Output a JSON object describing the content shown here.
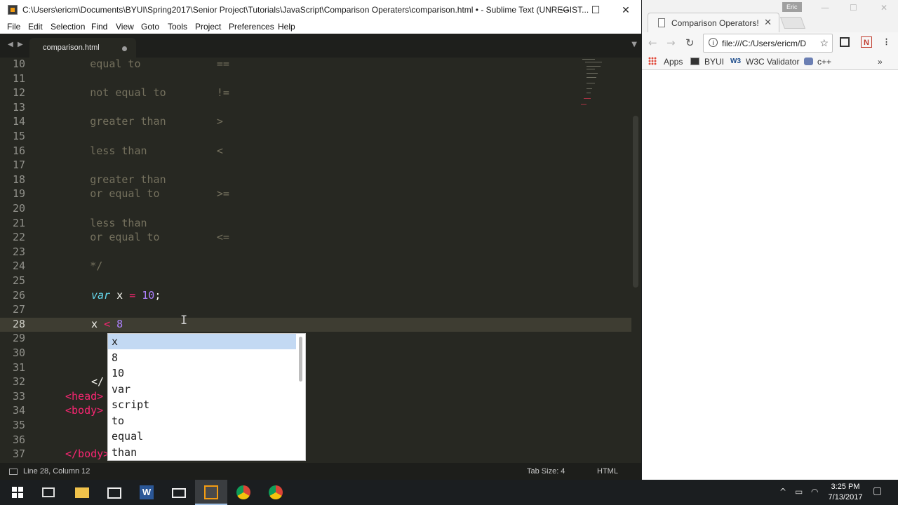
{
  "sublime": {
    "title": "C:\\Users\\ericm\\Documents\\BYUI\\Spring2017\\Senior Project\\Tutorials\\JavaScript\\Comparison Operaters\\comparison.html • - Sublime Text (UNREGIST...",
    "menu": [
      "File",
      "Edit",
      "Selection",
      "Find",
      "View",
      "Goto",
      "Tools",
      "Project",
      "Preferences",
      "Help"
    ],
    "tab_label": "comparison.html",
    "lines": [
      {
        "n": "10",
        "text": "        equal to            =="
      },
      {
        "n": "11",
        "text": ""
      },
      {
        "n": "12",
        "text": "        not equal to        !="
      },
      {
        "n": "13",
        "text": ""
      },
      {
        "n": "14",
        "text": "        greater than        >"
      },
      {
        "n": "15",
        "text": ""
      },
      {
        "n": "16",
        "text": "        less than           <"
      },
      {
        "n": "17",
        "text": ""
      },
      {
        "n": "18",
        "text": "        greater than"
      },
      {
        "n": "19",
        "text": "        or equal to         >="
      },
      {
        "n": "20",
        "text": ""
      },
      {
        "n": "21",
        "text": "        less than"
      },
      {
        "n": "22",
        "text": "        or equal to         <="
      },
      {
        "n": "23",
        "text": ""
      },
      {
        "n": "24",
        "text": "        */"
      },
      {
        "n": "25",
        "text": ""
      },
      {
        "n": "26",
        "var": "var",
        "x": "x",
        "eq": "=",
        "val": "10",
        "semi": ";"
      },
      {
        "n": "27",
        "text": ""
      },
      {
        "n": "28",
        "x": "x",
        "op": "<",
        "val": "8"
      },
      {
        "n": "29",
        "text": ""
      },
      {
        "n": "30",
        "text": ""
      },
      {
        "n": "31",
        "text": ""
      },
      {
        "n": "32",
        "text": "</"
      },
      {
        "n": "33",
        "text": "<head>"
      },
      {
        "n": "34",
        "text": "<body>"
      },
      {
        "n": "35",
        "text": ""
      },
      {
        "n": "36",
        "text": ""
      },
      {
        "n": "37",
        "text": "</body>"
      }
    ],
    "autocomplete": [
      "x",
      "8",
      "10",
      "var",
      "script",
      "to",
      "equal",
      "than"
    ],
    "status": {
      "position": "Line 28, Column 12",
      "tab_size": "Tab Size: 4",
      "syntax": "HTML"
    }
  },
  "chrome": {
    "user": "Eric",
    "tab_title": "Comparison Operators!",
    "url": "file:///C:/Users/ericm/D",
    "bookmarks": [
      "Apps",
      "BYUI",
      "W3C Validator",
      "c++"
    ]
  },
  "taskbar": {
    "time": "3:25 PM",
    "date": "7/13/2017"
  }
}
